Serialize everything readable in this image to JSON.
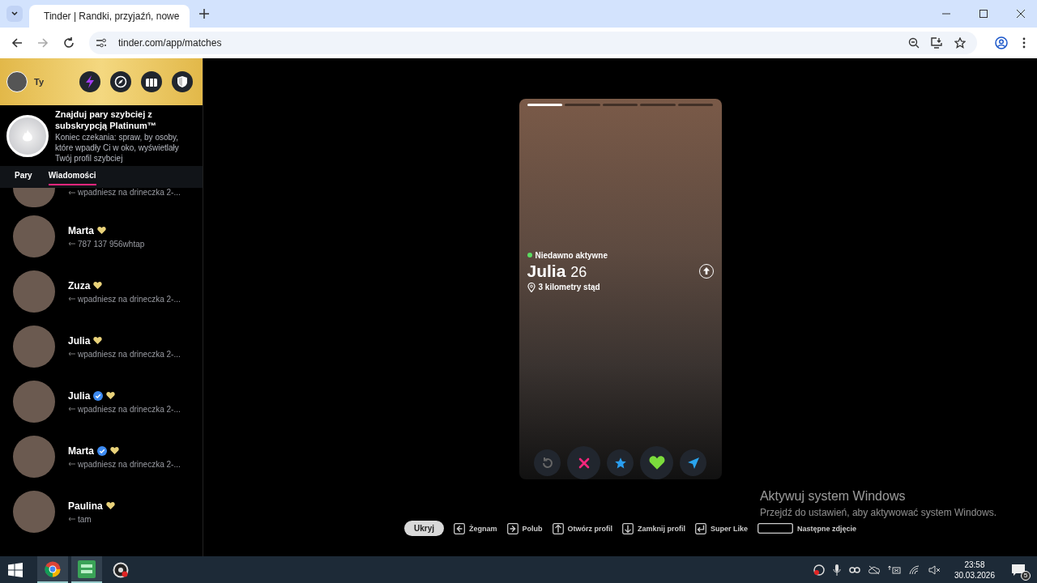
{
  "browser": {
    "tab_title": "Tinder | Randki, przyjaźń, nowe",
    "url": "tinder.com/app/matches"
  },
  "sidebar": {
    "user_label": "Ty",
    "promo": {
      "title": "Znajduj pary szybciej z subskrypcją Platinum™",
      "text": "Koniec czekania: spraw, by osoby, które wpadły Ci w oko, wyświetlały Twój profil szybciej"
    },
    "tabs": [
      {
        "label": "Pary",
        "selected": false
      },
      {
        "label": "Wiadomości",
        "selected": true
      }
    ],
    "conversations": [
      {
        "partial": true,
        "verified": false,
        "message": "wpadniesz na drineczka 2-..."
      },
      {
        "partial": false,
        "name": "Marta",
        "verified": false,
        "message": "787 137 956whtap"
      },
      {
        "partial": false,
        "name": "Zuza",
        "verified": false,
        "message": "wpadniesz na drineczka 2-..."
      },
      {
        "partial": false,
        "name": "Julia",
        "verified": false,
        "message": "wpadniesz na drineczka 2-..."
      },
      {
        "partial": false,
        "name": "Julia",
        "verified": true,
        "message": "wpadniesz na drineczka 2-..."
      },
      {
        "partial": false,
        "name": "Marta",
        "verified": true,
        "message": "wpadniesz na drineczka 2-..."
      },
      {
        "partial": false,
        "name": "Paulina",
        "verified": false,
        "message": "tam"
      }
    ]
  },
  "card": {
    "photos": [
      {
        "selected": true
      },
      {
        "selected": false
      },
      {
        "selected": false
      },
      {
        "selected": false
      },
      {
        "selected": false
      }
    ],
    "status": "Niedawno aktywne",
    "name": "Julia",
    "age": "26",
    "distance": "3 kilometry stąd"
  },
  "shortcuts": {
    "hide_button": "Ukryj",
    "keys": [
      {
        "kind": "left",
        "label": "Żegnam"
      },
      {
        "kind": "right",
        "label": "Polub"
      },
      {
        "kind": "up",
        "label": "Otwórz profil"
      },
      {
        "kind": "down",
        "label": "Zamknij profil"
      },
      {
        "kind": "enter",
        "label": "Super Like"
      },
      {
        "kind": "space",
        "label": "Następne zdjęcie"
      }
    ]
  },
  "watermark": {
    "title": "Aktywuj system Windows",
    "text": "Przejdź do ustawień, aby aktywować system Windows."
  },
  "taskbar": {
    "time": "23:58",
    "date": "30.03.2026",
    "notifications": "5"
  }
}
